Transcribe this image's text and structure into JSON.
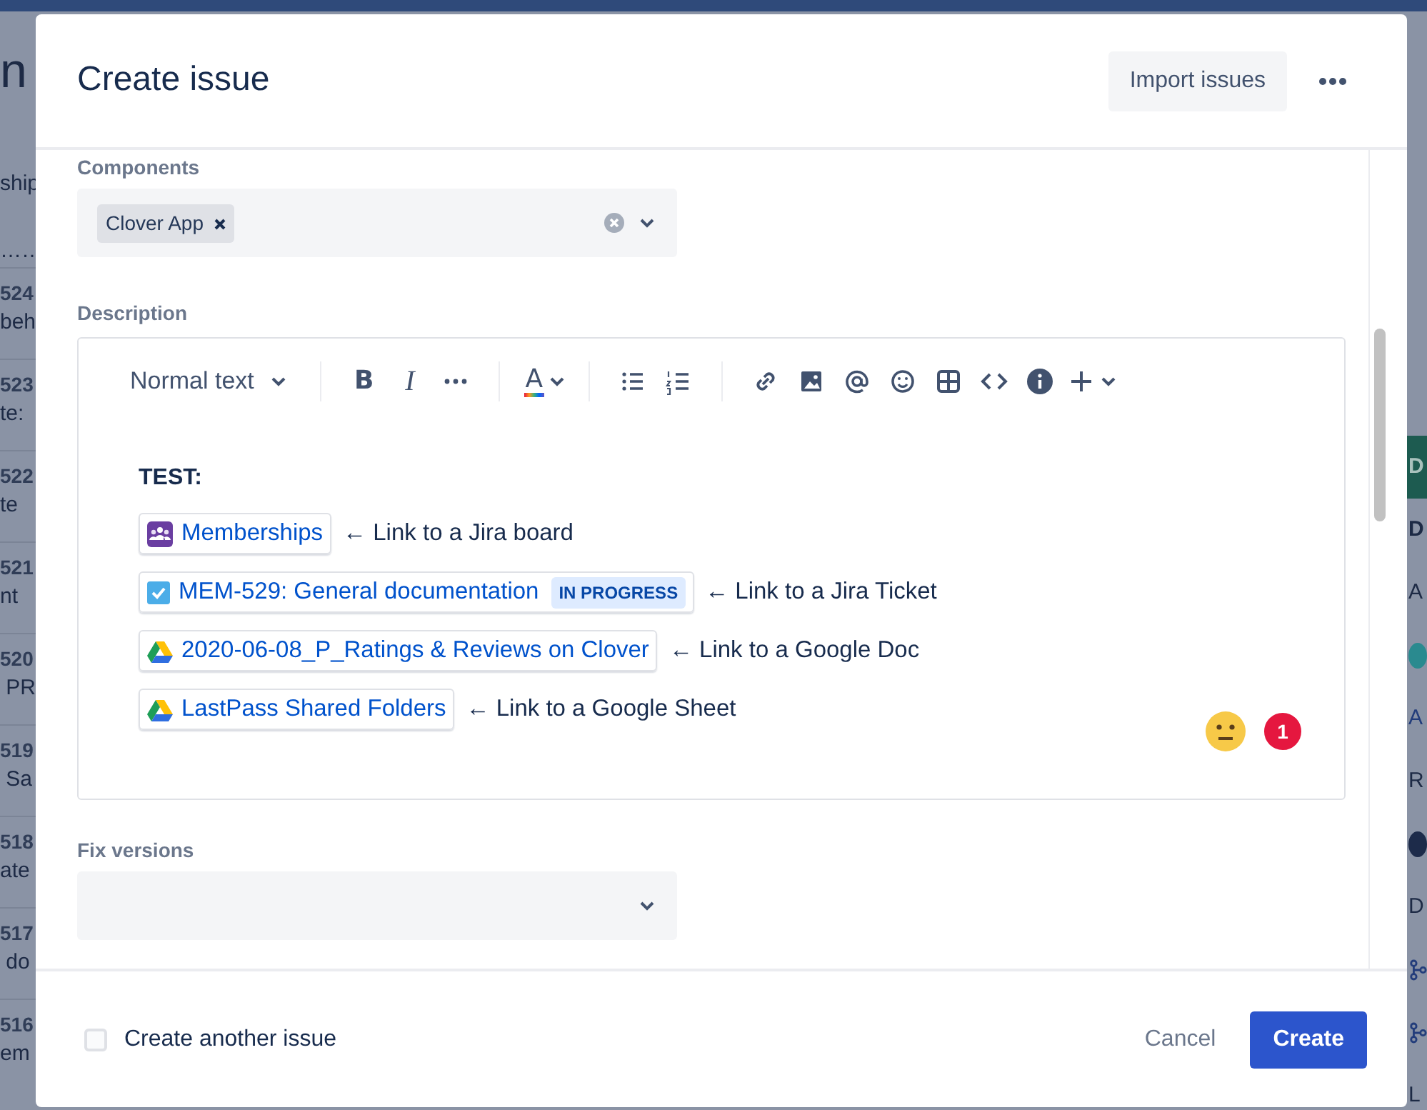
{
  "backdrop": {
    "title_fragment": "n",
    "subtitle_fragment": "ship",
    "dots": "……",
    "issues": [
      {
        "key": "524",
        "summary": "beh"
      },
      {
        "key": "523",
        "summary": "te:"
      },
      {
        "key": "522",
        "summary": "te"
      },
      {
        "key": "521",
        "summary": "nt"
      },
      {
        "key": "520",
        "summary": " PR"
      },
      {
        "key": "519",
        "summary": " Sa"
      },
      {
        "key": "518",
        "summary": "ate"
      },
      {
        "key": "517",
        "summary": " do"
      },
      {
        "key": "516",
        "summary": "em"
      }
    ],
    "right_fragments": [
      {
        "kind": "tab",
        "text": "D"
      },
      {
        "kind": "heading",
        "text": "D"
      },
      {
        "kind": "label",
        "text": "A"
      },
      {
        "kind": "avatar",
        "color": "#2a8a8f"
      },
      {
        "kind": "link",
        "text": "A"
      },
      {
        "kind": "label",
        "text": "R"
      },
      {
        "kind": "avatar",
        "color": "#1d2b4a"
      },
      {
        "kind": "label",
        "text": "D"
      },
      {
        "kind": "branch"
      },
      {
        "kind": "branch"
      },
      {
        "kind": "label",
        "text": "L"
      }
    ]
  },
  "modal": {
    "title": "Create issue",
    "import_button": "Import issues",
    "components": {
      "label": "Components",
      "chips": [
        {
          "label": "Clover App"
        }
      ]
    },
    "description": {
      "label": "Description",
      "toolbar": {
        "style_menu": "Normal text",
        "groups": [
          [
            {
              "kind": "bold",
              "label": "B"
            },
            {
              "kind": "italic",
              "label": "I"
            },
            {
              "kind": "more"
            }
          ],
          [
            {
              "kind": "color",
              "label": "A"
            }
          ],
          [
            {
              "kind": "bullets"
            },
            {
              "kind": "numbers"
            }
          ],
          [
            {
              "kind": "link"
            },
            {
              "kind": "image"
            },
            {
              "kind": "mention"
            },
            {
              "kind": "emoji"
            },
            {
              "kind": "table"
            },
            {
              "kind": "code"
            },
            {
              "kind": "info"
            },
            {
              "kind": "insert"
            }
          ]
        ]
      },
      "heading": "TEST:",
      "lines": [
        {
          "kind": "board",
          "link": "Memberships",
          "note": "← Link to a Jira board"
        },
        {
          "kind": "ticket",
          "link": "MEM-529: General documentation",
          "status": "IN PROGRESS",
          "note": "← Link to a Jira Ticket"
        },
        {
          "kind": "drive",
          "link": "2020-06-08_P_Ratings & Reviews on Clover",
          "note": "← Link to a Google Doc"
        },
        {
          "kind": "drive",
          "link": "LastPass Shared Folders",
          "note": "← Link to a Google Sheet"
        }
      ],
      "badge": "1"
    },
    "fix_versions": {
      "label": "Fix versions"
    },
    "footer": {
      "checkbox": {
        "label": "Create another issue",
        "checked": false
      },
      "cancel": "Cancel",
      "create": "Create"
    }
  }
}
